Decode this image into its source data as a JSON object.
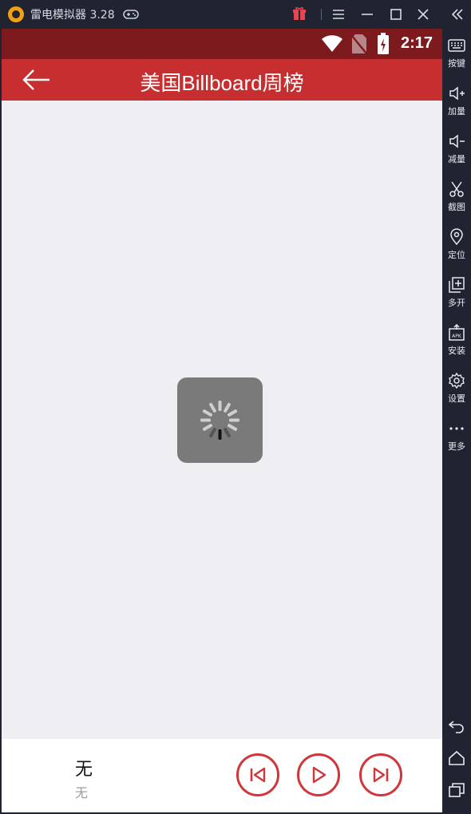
{
  "emulator": {
    "app_name": "雷电模拟器 3.28",
    "sidebar": [
      {
        "label": "按键",
        "icon": "keyboard-icon"
      },
      {
        "label": "加量",
        "icon": "volume-up-icon"
      },
      {
        "label": "减量",
        "icon": "volume-down-icon"
      },
      {
        "label": "截图",
        "icon": "scissors-icon"
      },
      {
        "label": "定位",
        "icon": "location-pin-icon"
      },
      {
        "label": "多开",
        "icon": "multi-open-icon"
      },
      {
        "label": "安装",
        "icon": "apk-install-icon"
      },
      {
        "label": "设置",
        "icon": "gear-icon"
      },
      {
        "label": "更多",
        "icon": "more-dots-icon"
      }
    ],
    "nav": [
      "back-nav-icon",
      "home-nav-icon",
      "recent-apps-icon"
    ],
    "accent_gift": "#e64552"
  },
  "status_bar": {
    "time": "2:17",
    "color": "#7d1a1d"
  },
  "app_bar": {
    "title": "美国Billboard周榜",
    "color": "#c72e2f"
  },
  "player": {
    "song_title": "无",
    "artist": "无",
    "control_color": "#d0363a"
  }
}
